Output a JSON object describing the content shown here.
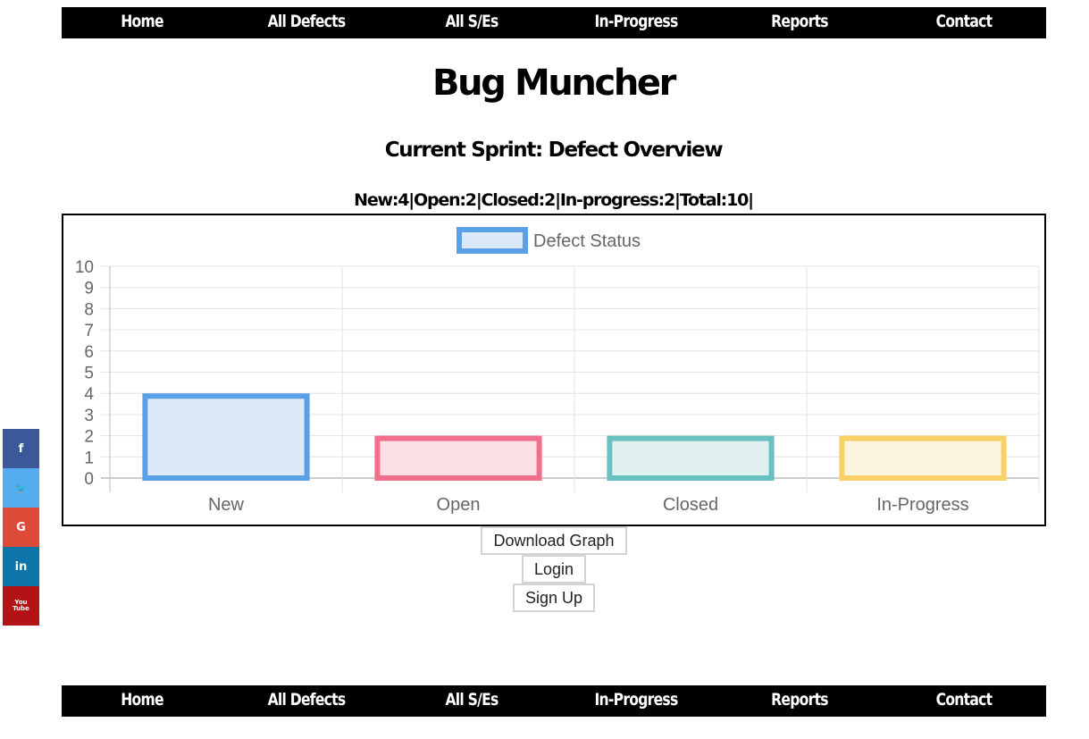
{
  "nav": {
    "items": [
      "Home",
      "All Defects",
      "All S/Es",
      "In-Progress",
      "Reports",
      "Contact"
    ]
  },
  "header": {
    "title": "Bug Muncher",
    "subtitle": "Current Sprint: Defect Overview",
    "summary": "New:4|Open:2|Closed:2|In-progress:2|Total:10|"
  },
  "buttons": {
    "download": "Download Graph",
    "login": "Login",
    "signup": "Sign Up"
  },
  "social": [
    {
      "icon": "facebook-icon",
      "glyph": "f",
      "color": "#3b5998"
    },
    {
      "icon": "twitter-icon",
      "glyph": "🐦",
      "color": "#55acee"
    },
    {
      "icon": "google-plus-icon",
      "glyph": "G",
      "color": "#dd4b39"
    },
    {
      "icon": "linkedin-icon",
      "glyph": "in",
      "color": "#0e76a8"
    },
    {
      "icon": "youtube-icon",
      "glyph": "You\nTube",
      "color": "#b31217"
    }
  ],
  "footer_nav": {
    "items": [
      "Home",
      "All Defects",
      "All S/Es",
      "In-Progress",
      "Reports",
      "Contact"
    ]
  },
  "chart_data": {
    "type": "bar",
    "categories": [
      "New",
      "Open",
      "Closed",
      "In-Progress"
    ],
    "series": [
      {
        "name": "Defect Status",
        "values": [
          4,
          2,
          2,
          2
        ]
      }
    ],
    "bar_colors": [
      {
        "border": "#5aa0e6",
        "fill": "#dbe9f8"
      },
      {
        "border": "#ef6f8c",
        "fill": "#fbe1e6"
      },
      {
        "border": "#68c0c0",
        "fill": "#dff0ef"
      },
      {
        "border": "#f8d067",
        "fill": "#fcf4dd"
      }
    ],
    "legend_color": {
      "border": "#5aa0e6",
      "fill": "#dbe9f8"
    },
    "ylim": [
      0,
      10
    ],
    "yticks": [
      0,
      1,
      2,
      3,
      4,
      5,
      6,
      7,
      8,
      9,
      10
    ],
    "grid": true,
    "legend_position": "top"
  }
}
